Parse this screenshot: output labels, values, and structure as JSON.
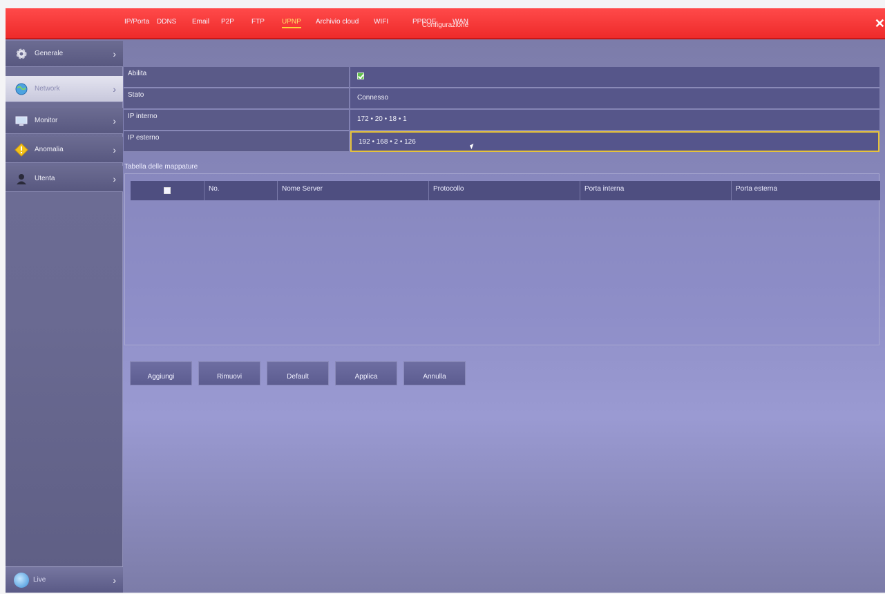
{
  "window": {
    "title": "Configurazione",
    "close_icon": "close-icon"
  },
  "sidebar": {
    "items": [
      {
        "label": "Generale",
        "icon": "gear-icon",
        "active": false
      },
      {
        "label": "Network",
        "icon": "globe-icon",
        "active": true
      },
      {
        "label": "Monitor",
        "icon": "monitor-icon",
        "active": false
      },
      {
        "label": "Anomalia",
        "icon": "warning-icon",
        "active": false
      },
      {
        "label": "Utenta",
        "icon": "user-icon",
        "active": false
      }
    ],
    "live": {
      "label": "Live",
      "icon": "live-icon"
    }
  },
  "tabs": [
    {
      "label": "IP/Porta"
    },
    {
      "label": "DDNS"
    },
    {
      "label": "Email"
    },
    {
      "label": "P2P"
    },
    {
      "label": "FTP"
    },
    {
      "label": "UPNP",
      "active": true
    },
    {
      "label": "Archivio cloud"
    },
    {
      "label": "WIFI"
    },
    {
      "label": "PPPOE"
    },
    {
      "label": "WAN"
    }
  ],
  "form": {
    "enable_label": "Abilita",
    "enable_checked": true,
    "status_label": "Stato",
    "status_value": "Connesso",
    "internal_ip_label": "IP interno",
    "internal_ip": "172 • 20 • 18 • 1",
    "external_ip_label": "IP esterno",
    "external_ip": "192 • 168 • 2 • 126"
  },
  "mapping": {
    "title": "Tabella delle mappature",
    "columns": [
      "No.",
      "Nome Server",
      "Protocollo",
      "Porta interna",
      "Porta esterna"
    ],
    "rows": []
  },
  "buttons": {
    "add": "Aggiungi",
    "remove": "Rimuovi",
    "default": "Default",
    "apply": "Applica",
    "cancel": "Annulla"
  },
  "colors": {
    "titlebar": "#ee2a2a",
    "active_tab": "#ffd43b",
    "focus_border": "#e6c23a",
    "checkbox": "#5fbf4a"
  }
}
